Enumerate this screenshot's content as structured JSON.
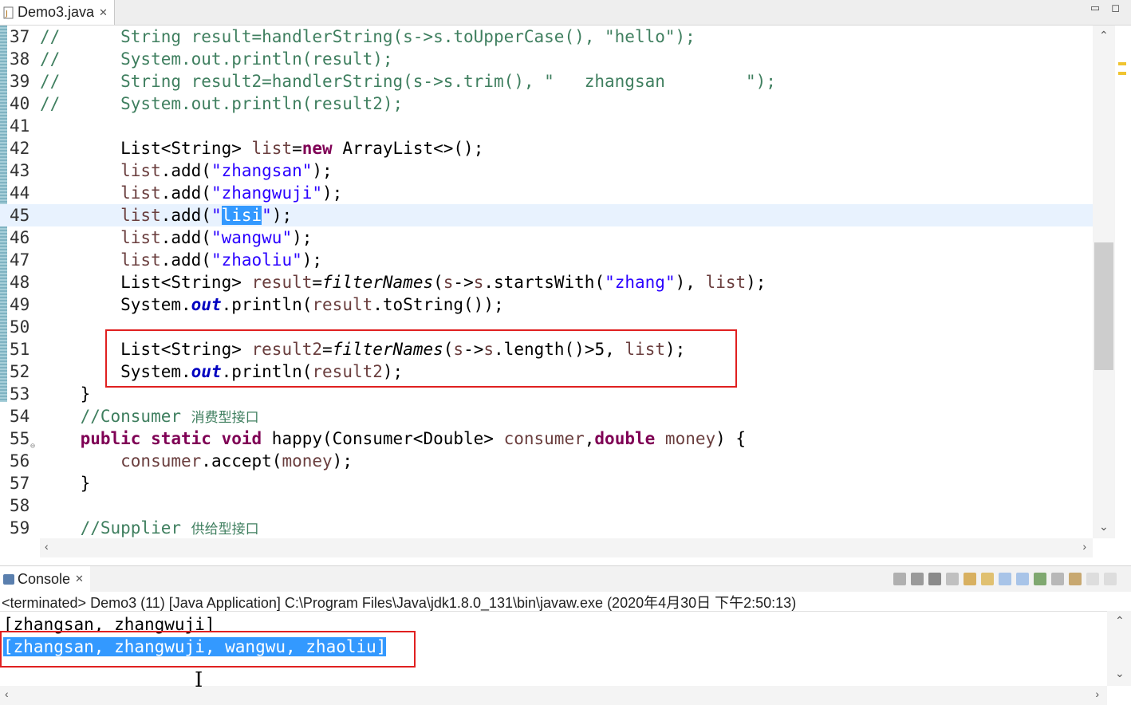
{
  "tab": {
    "title": "Demo3.java",
    "close": "✕"
  },
  "window_controls": {
    "minimize": "▭",
    "maximize": "◻"
  },
  "editor": {
    "lines": [
      {
        "n": "37",
        "segs": [
          {
            "c": "cm",
            "t": "//      String result=handlerString(s->s.toUpperCase(), \"hello\");"
          }
        ]
      },
      {
        "n": "38",
        "segs": [
          {
            "c": "cm",
            "t": "//      System.out.println(result);"
          }
        ]
      },
      {
        "n": "39",
        "segs": [
          {
            "c": "cm",
            "t": "//      String result2=handlerString(s->s.trim(), \"   zhangsan        \");"
          }
        ]
      },
      {
        "n": "40",
        "segs": [
          {
            "c": "cm",
            "t": "//      System.out.println(result2);"
          }
        ]
      },
      {
        "n": "41",
        "segs": []
      },
      {
        "n": "42",
        "segs": [
          {
            "c": "",
            "t": "        List<String> "
          },
          {
            "c": "var",
            "t": "list"
          },
          {
            "c": "",
            "t": "="
          },
          {
            "c": "kw",
            "t": "new"
          },
          {
            "c": "",
            "t": " ArrayList<>();"
          }
        ]
      },
      {
        "n": "43",
        "segs": [
          {
            "c": "var",
            "t": "        list"
          },
          {
            "c": "",
            "t": ".add("
          },
          {
            "c": "str",
            "t": "\"zhangsan\""
          },
          {
            "c": "",
            "t": ");"
          }
        ]
      },
      {
        "n": "44",
        "segs": [
          {
            "c": "var",
            "t": "        list"
          },
          {
            "c": "",
            "t": ".add("
          },
          {
            "c": "str",
            "t": "\"zhangwuji\""
          },
          {
            "c": "",
            "t": ");"
          }
        ]
      },
      {
        "n": "45",
        "current": true,
        "segs": [
          {
            "c": "var",
            "t": "        list"
          },
          {
            "c": "",
            "t": ".add("
          },
          {
            "c": "str",
            "t": "\""
          },
          {
            "c": "str sel",
            "t": "lisi"
          },
          {
            "c": "str",
            "t": "\""
          },
          {
            "c": "",
            "t": ");"
          }
        ]
      },
      {
        "n": "46",
        "segs": [
          {
            "c": "var",
            "t": "        list"
          },
          {
            "c": "",
            "t": ".add("
          },
          {
            "c": "str",
            "t": "\"wangwu\""
          },
          {
            "c": "",
            "t": ");"
          }
        ]
      },
      {
        "n": "47",
        "segs": [
          {
            "c": "var",
            "t": "        list"
          },
          {
            "c": "",
            "t": ".add("
          },
          {
            "c": "str",
            "t": "\"zhaoliu\""
          },
          {
            "c": "",
            "t": ");"
          }
        ]
      },
      {
        "n": "48",
        "segs": [
          {
            "c": "",
            "t": "        List<String> "
          },
          {
            "c": "var",
            "t": "result"
          },
          {
            "c": "",
            "t": "="
          },
          {
            "c": "it",
            "t": "filterNames"
          },
          {
            "c": "",
            "t": "("
          },
          {
            "c": "var",
            "t": "s"
          },
          {
            "c": "",
            "t": "->"
          },
          {
            "c": "var",
            "t": "s"
          },
          {
            "c": "",
            "t": ".startsWith("
          },
          {
            "c": "str",
            "t": "\"zhang\""
          },
          {
            "c": "",
            "t": "), "
          },
          {
            "c": "var",
            "t": "list"
          },
          {
            "c": "",
            "t": ");"
          }
        ]
      },
      {
        "n": "49",
        "segs": [
          {
            "c": "",
            "t": "        System."
          },
          {
            "c": "fld",
            "t": "out"
          },
          {
            "c": "",
            "t": ".println("
          },
          {
            "c": "var",
            "t": "result"
          },
          {
            "c": "",
            "t": ".toString());"
          }
        ]
      },
      {
        "n": "50",
        "segs": []
      },
      {
        "n": "51",
        "segs": [
          {
            "c": "",
            "t": "        List<String> "
          },
          {
            "c": "var",
            "t": "result2"
          },
          {
            "c": "",
            "t": "="
          },
          {
            "c": "it",
            "t": "filterNames"
          },
          {
            "c": "",
            "t": "("
          },
          {
            "c": "var",
            "t": "s"
          },
          {
            "c": "",
            "t": "->"
          },
          {
            "c": "var",
            "t": "s"
          },
          {
            "c": "",
            "t": ".length()>5, "
          },
          {
            "c": "var",
            "t": "list"
          },
          {
            "c": "",
            "t": ");"
          }
        ]
      },
      {
        "n": "52",
        "segs": [
          {
            "c": "",
            "t": "        System."
          },
          {
            "c": "fld",
            "t": "out"
          },
          {
            "c": "",
            "t": ".println("
          },
          {
            "c": "var",
            "t": "result2"
          },
          {
            "c": "",
            "t": ");"
          }
        ]
      },
      {
        "n": "53",
        "segs": [
          {
            "c": "",
            "t": "    }"
          }
        ]
      },
      {
        "n": "54",
        "segs": [
          {
            "c": "cm",
            "t": "    //Consumer "
          },
          {
            "c": "cjk",
            "t": "消费型接口"
          }
        ]
      },
      {
        "n": "55",
        "fold": true,
        "segs": [
          {
            "c": "kw",
            "t": "    public static void"
          },
          {
            "c": "",
            "t": " happy(Consumer<Double> "
          },
          {
            "c": "var",
            "t": "consumer"
          },
          {
            "c": "",
            "t": ","
          },
          {
            "c": "kw",
            "t": "double"
          },
          {
            "c": "",
            "t": " "
          },
          {
            "c": "var",
            "t": "money"
          },
          {
            "c": "",
            "t": ") {"
          }
        ]
      },
      {
        "n": "56",
        "segs": [
          {
            "c": "var",
            "t": "        consumer"
          },
          {
            "c": "",
            "t": ".accept("
          },
          {
            "c": "var",
            "t": "money"
          },
          {
            "c": "",
            "t": ");"
          }
        ]
      },
      {
        "n": "57",
        "segs": [
          {
            "c": "",
            "t": "    }"
          }
        ]
      },
      {
        "n": "58",
        "segs": []
      },
      {
        "n": "59",
        "segs": [
          {
            "c": "cm",
            "t": "    //Supplier "
          },
          {
            "c": "cjk",
            "t": "供给型接口"
          }
        ]
      }
    ]
  },
  "console": {
    "tab_title": "Console",
    "tab_close": "✕",
    "status": "<terminated> Demo3 (11) [Java Application] C:\\Program Files\\Java\\jdk1.8.0_131\\bin\\javaw.exe (2020年4月30日 下午2:50:13)",
    "output": [
      "[zhangsan, zhangwuji]",
      "[zhangsan, zhangwuji, wangwu, zhaoliu]"
    ]
  },
  "colors": {
    "keyword": "#7f0055",
    "string": "#2a00ff",
    "comment": "#3f7f5f",
    "variable": "#6a3e3e",
    "highlight_box": "#e02020",
    "selection": "#3399ff"
  }
}
